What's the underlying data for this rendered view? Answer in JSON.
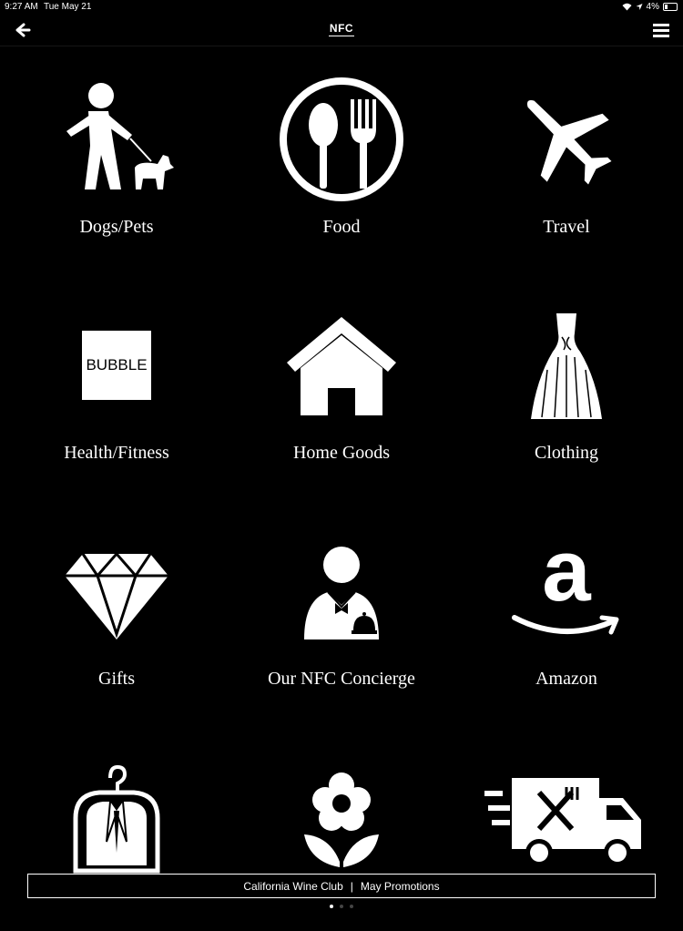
{
  "status_bar": {
    "time": "9:27 AM",
    "date": "Tue May 21",
    "battery": "4%"
  },
  "header": {
    "title": "NFC"
  },
  "categories": [
    {
      "label": "Dogs/Pets",
      "icon": "dog-walker-icon"
    },
    {
      "label": "Food",
      "icon": "spoon-fork-icon"
    },
    {
      "label": "Travel",
      "icon": "airplane-icon"
    },
    {
      "label": "Health/Fitness",
      "icon": "bubble-logo-icon",
      "icon_text": "BUBBLE"
    },
    {
      "label": "Home Goods",
      "icon": "house-icon"
    },
    {
      "label": "Clothing",
      "icon": "dress-icon"
    },
    {
      "label": "Gifts",
      "icon": "diamond-icon"
    },
    {
      "label": "Our NFC Concierge",
      "icon": "concierge-icon"
    },
    {
      "label": "Amazon",
      "icon": "amazon-logo-icon",
      "icon_text": "a"
    },
    {
      "label": "",
      "icon": "suit-garment-bag-icon"
    },
    {
      "label": "",
      "icon": "flower-icon"
    },
    {
      "label": "",
      "icon": "food-delivery-truck-icon"
    }
  ],
  "promo": {
    "left": "California Wine Club",
    "separator": "|",
    "right": "May Promotions"
  },
  "pager": {
    "pages": 3,
    "active": 1
  },
  "colors": {
    "background": "#000000",
    "foreground": "#ffffff"
  }
}
